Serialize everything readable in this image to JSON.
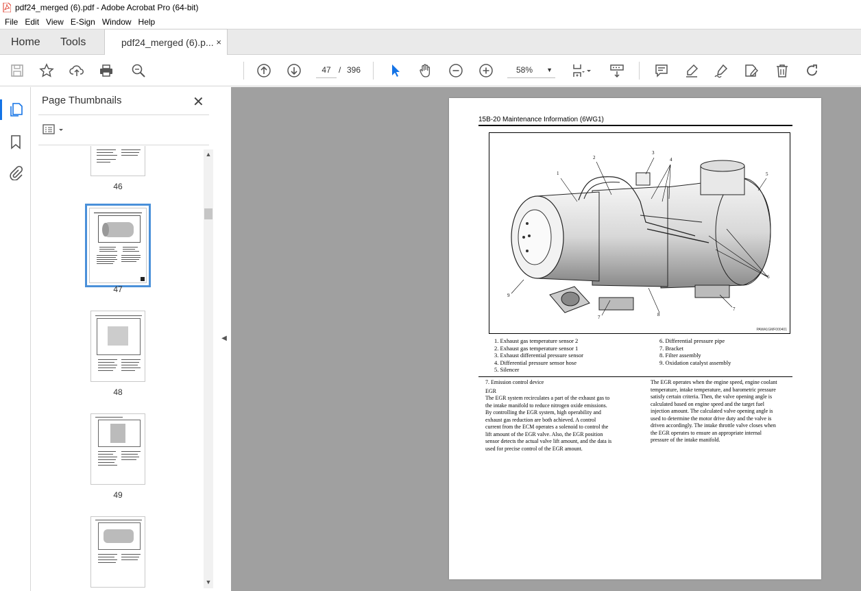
{
  "window": {
    "title": "pdf24_merged (6).pdf - Adobe Acrobat Pro (64-bit)"
  },
  "menu": [
    "File",
    "Edit",
    "View",
    "E-Sign",
    "Window",
    "Help"
  ],
  "tabs": {
    "home": "Home",
    "tools": "Tools",
    "document": "pdf24_merged (6).p...",
    "close": "×"
  },
  "toolbar": {
    "current_page": "47",
    "separator": "/",
    "total_pages": "396",
    "zoom": "58%",
    "icons": [
      "save-icon",
      "star-icon",
      "upload-icon",
      "print-icon",
      "search-zoom-icon",
      "page-up-icon",
      "page-down-icon",
      "select-cursor-icon",
      "hand-icon",
      "zoom-out-icon",
      "zoom-in-icon",
      "page-fit-icon",
      "scroll-mode-icon",
      "comment-icon",
      "highlight-icon",
      "sign-icon",
      "edit-icon",
      "delete-icon",
      "redo-icon"
    ]
  },
  "panel": {
    "title": "Page Thumbnails",
    "thumbnails": [
      {
        "label": "46"
      },
      {
        "label": "47",
        "selected": true
      },
      {
        "label": "48"
      },
      {
        "label": "49"
      },
      {
        "label": ""
      }
    ]
  },
  "document": {
    "header": "15B-20  Maintenance Information (6WG1)",
    "figure_id": "PAWA1GMF000401",
    "callouts": [
      "1",
      "2",
      "3",
      "4",
      "5",
      "6",
      "7",
      "7",
      "8",
      "9"
    ],
    "legend_left": [
      "1.    Exhaust gas temperature sensor 2",
      "2.    Exhaust gas temperature sensor 1",
      "3.    Exhaust differential pressure sensor",
      "4.    Differential pressure sensor hose",
      "5.    Silencer"
    ],
    "legend_right": [
      "6.    Differential pressure pipe",
      "7.    Bracket",
      "8.    Filter assembly",
      "9.    Oxidation catalyst assembly"
    ],
    "section_title": "7.    Emission control device",
    "subheading": "EGR",
    "left_paragraph": [
      "The EGR system recirculates a part of the exhaust gas to",
      "the intake manifold to reduce nitrogen oxide emissions.",
      "By controlling the EGR system, high operability and",
      "exhaust gas reduction are both achieved. A control",
      "current from the ECM operates a solenoid to control the",
      "lift amount of the EGR valve. Also, the EGR position",
      "sensor detects the actual valve lift amount, and the data is",
      "used for precise control of the EGR amount."
    ],
    "right_paragraph": [
      "The EGR operates when the engine speed, engine coolant",
      "temperature, intake temperature, and barometric pressure",
      "satisfy certain criteria. Then, the valve opening angle is",
      "calculated based on engine speed and the target fuel",
      "injection amount. The calculated valve opening angle is",
      "used to determine the motor drive duty and the valve is",
      "driven accordingly. The intake throttle valve closes when",
      "the EGR operates to ensure an appropriate internal",
      "pressure of the intake manifold."
    ]
  }
}
